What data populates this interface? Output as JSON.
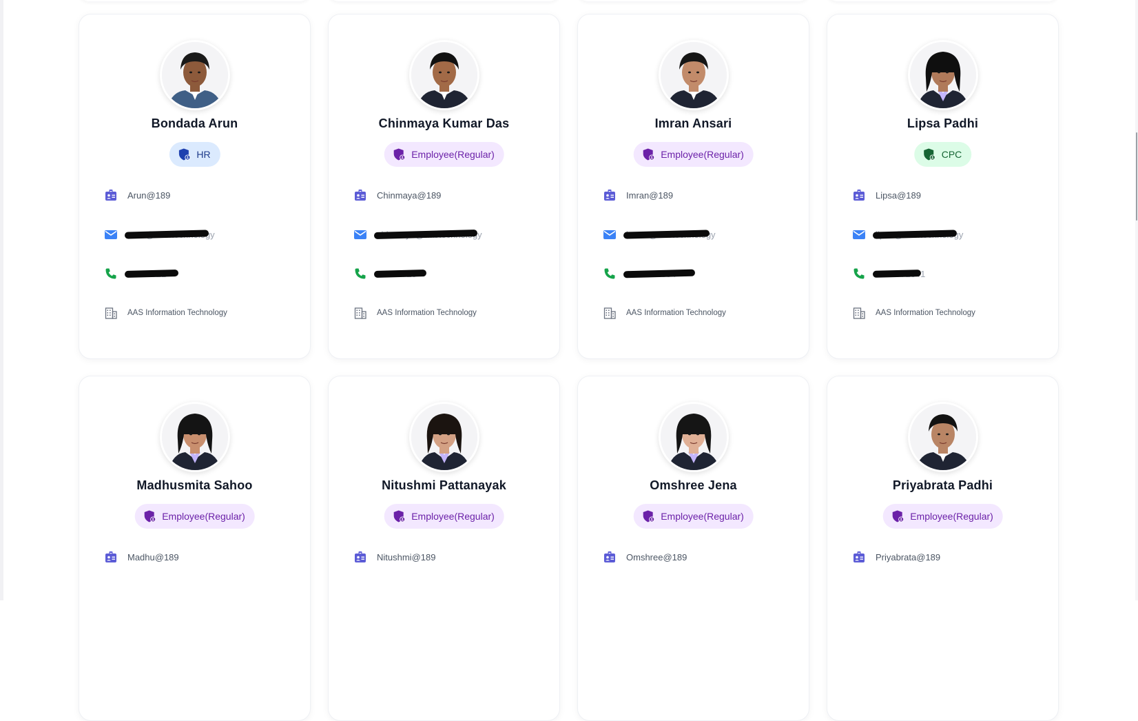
{
  "colors": {
    "id_icon": "#5b5bd6",
    "mail_icon": "#3b82f6",
    "phone_icon": "#16a34a",
    "company_icon": "#6b7280",
    "badge_purple_bg": "#f3e8ff",
    "badge_blue_bg": "#dbeafe",
    "badge_green_bg": "#dcfce7"
  },
  "icons": {
    "id": "id-card-icon",
    "mail": "mail-icon",
    "phone": "phone-icon",
    "company": "building-icon",
    "role": "shield-user-icon"
  },
  "employees": [
    {
      "name": "Bondada Arun",
      "role": "HR",
      "role_style": "blue",
      "username": "Arun@189",
      "email": "arun@aas.technology",
      "phone": "9••••••821",
      "company": "AAS Information Technology"
    },
    {
      "name": "Chinmaya Kumar Das",
      "role": "Employee(Regular)",
      "role_style": "purple",
      "username": "Chinmaya@189",
      "email": "chinmaya@aastechnology",
      "phone": "86706725",
      "company": "AAS Information Technology"
    },
    {
      "name": "Imran Ansari",
      "role": "Employee(Regular)",
      "role_style": "purple",
      "username": "Imran@189",
      "email": "imran@aastechnology",
      "phone": "9600252334",
      "company": "AAS Information Technology"
    },
    {
      "name": "Lipsa Padhi",
      "role": "CPC",
      "role_style": "green",
      "username": "Lipsa@189",
      "email": "lipsa@aas.technology",
      "phone": "7408571641",
      "company": "AAS Information Technology"
    },
    {
      "name": "Madhusmita Sahoo",
      "role": "Employee(Regular)",
      "role_style": "purple",
      "username": "Madhu@189"
    },
    {
      "name": "Nitushmi Pattanayak",
      "role": "Employee(Regular)",
      "role_style": "purple",
      "username": "Nitushmi@189"
    },
    {
      "name": "Omshree Jena",
      "role": "Employee(Regular)",
      "role_style": "purple",
      "username": "Omshree@189"
    },
    {
      "name": "Priyabrata Padhi",
      "role": "Employee(Regular)",
      "role_style": "purple",
      "username": "Priyabrata@189"
    }
  ]
}
